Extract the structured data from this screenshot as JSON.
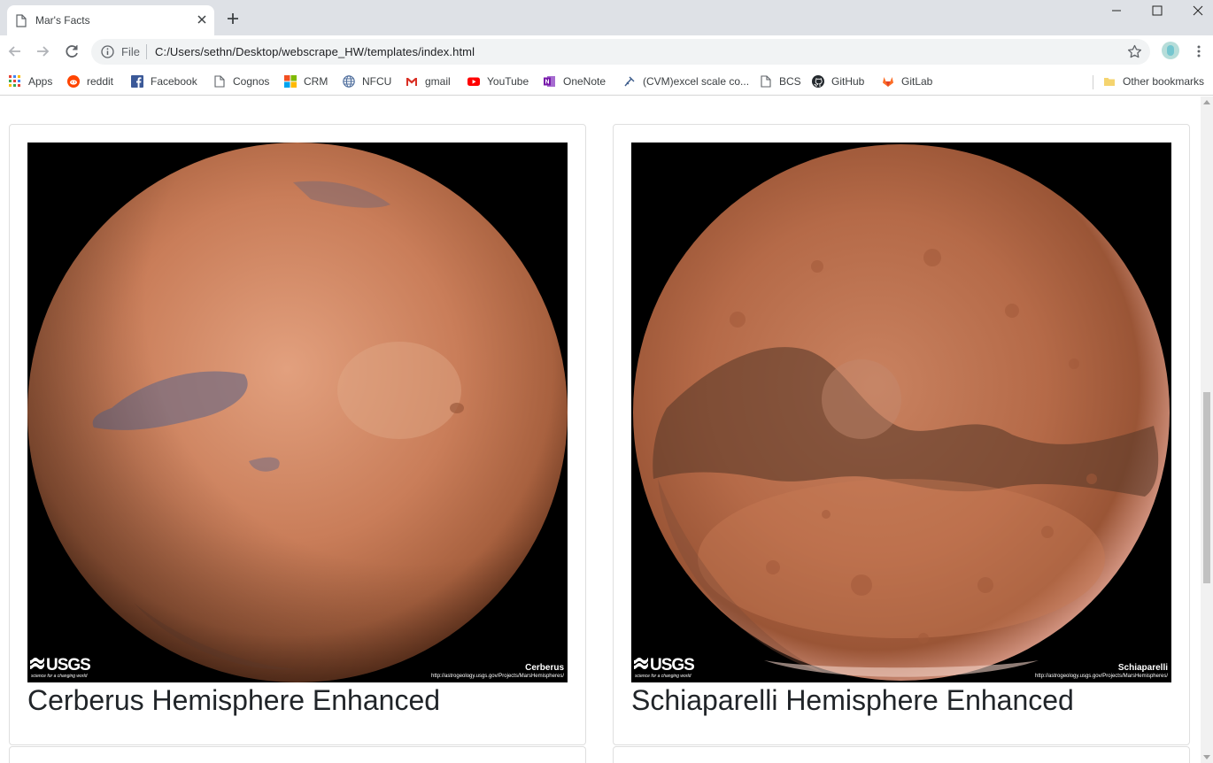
{
  "browser": {
    "tab": {
      "title": "Mar's Facts"
    },
    "address": {
      "chip": "File",
      "url": "C:/Users/sethn/Desktop/webscrape_HW/templates/index.html"
    },
    "bookmarks": [
      {
        "label": "Apps",
        "icon": "apps-grid-icon"
      },
      {
        "label": "reddit",
        "icon": "reddit-icon"
      },
      {
        "label": "Facebook",
        "icon": "facebook-icon"
      },
      {
        "label": "Cognos",
        "icon": "page-icon"
      },
      {
        "label": "CRM",
        "icon": "microsoft-icon"
      },
      {
        "label": "NFCU",
        "icon": "globe-icon"
      },
      {
        "label": "gmail",
        "icon": "gmail-icon"
      },
      {
        "label": "YouTube",
        "icon": "youtube-icon"
      },
      {
        "label": "OneNote",
        "icon": "onenote-icon"
      },
      {
        "label": "(CVM)excel scale co...",
        "icon": "tool-icon"
      },
      {
        "label": "BCS",
        "icon": "page-icon"
      },
      {
        "label": "GitHub",
        "icon": "github-icon"
      },
      {
        "label": "GitLab",
        "icon": "gitlab-icon"
      }
    ],
    "other_bookmarks": "Other bookmarks"
  },
  "page": {
    "hemispheres": [
      {
        "title": "Cerberus Hemisphere Enhanced",
        "image_caption": "Cerberus",
        "image_url_text": "http://astrogeology.usgs.gov/Projects/MarsHemispheres/",
        "logo_text": "USGS",
        "logo_tagline": "science for a changing world"
      },
      {
        "title": "Schiaparelli Hemisphere Enhanced",
        "image_caption": "Schiaparelli",
        "image_url_text": "http://astrogeology.usgs.gov/Projects/MarsHemispheres/",
        "logo_text": "USGS",
        "logo_tagline": "science for a changing world"
      }
    ]
  },
  "colors": {
    "mars_light": "#d8906d",
    "mars_mid": "#b4643f",
    "mars_dark": "#6e3a24",
    "mars_blue_gray": "#6f6a78"
  }
}
